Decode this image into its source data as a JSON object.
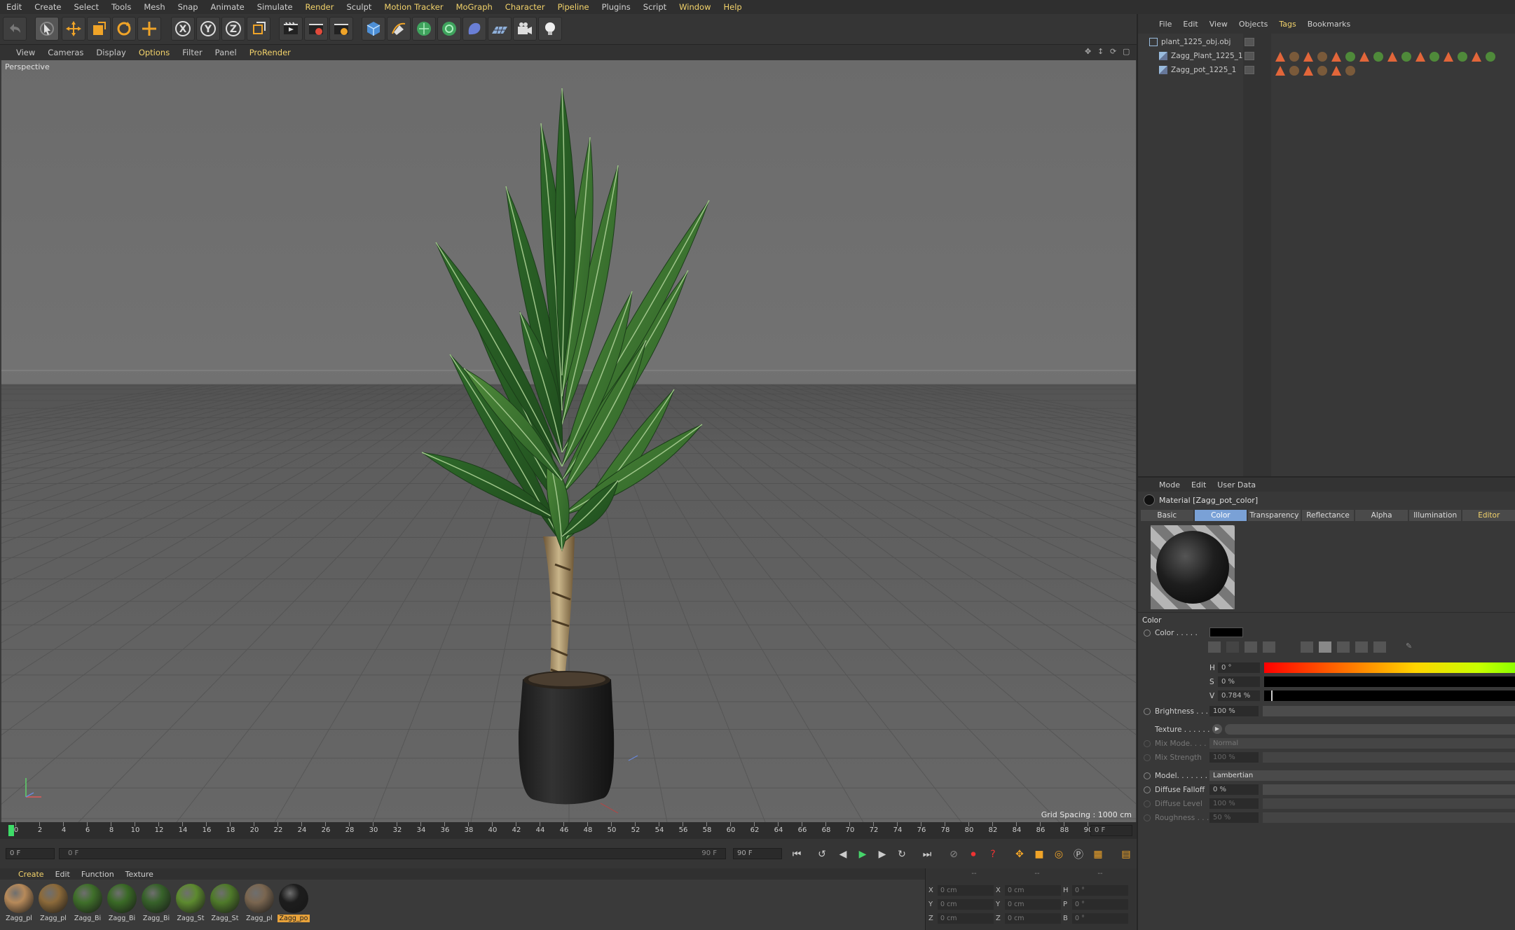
{
  "menubar": [
    "Edit",
    "Create",
    "Select",
    "Tools",
    "Mesh",
    "Snap",
    "Animate",
    "Simulate",
    "Render",
    "Sculpt",
    "Motion Tracker",
    "MoGraph",
    "Character",
    "Pipeline",
    "Plugins",
    "Script",
    "Window",
    "Help"
  ],
  "viewport_menu": [
    "View",
    "Cameras",
    "Display",
    "Options",
    "Filter",
    "Panel",
    "ProRender"
  ],
  "viewport": {
    "label": "Perspective",
    "grid_spacing": "Grid Spacing : 1000 cm"
  },
  "timeline": {
    "ticks": [
      "0",
      "2",
      "4",
      "6",
      "8",
      "10",
      "12",
      "14",
      "16",
      "18",
      "20",
      "22",
      "24",
      "26",
      "28",
      "30",
      "32",
      "34",
      "36",
      "38",
      "40",
      "42",
      "44",
      "46",
      "48",
      "50",
      "52",
      "54",
      "56",
      "58",
      "60",
      "62",
      "64",
      "66",
      "68",
      "70",
      "72",
      "74",
      "76",
      "78",
      "80",
      "82",
      "84",
      "86",
      "88",
      "90"
    ],
    "current_frame": "0 F",
    "start_field": "0 F",
    "range_start": "0 F",
    "range_end": "90 F",
    "end_field": "90 F"
  },
  "material_menu": [
    "Create",
    "Edit",
    "Function",
    "Texture"
  ],
  "materials": [
    {
      "label": "Zagg_pl",
      "color": "#b78a5a"
    },
    {
      "label": "Zagg_pl",
      "color": "#8c6a3a"
    },
    {
      "label": "Zagg_Bi",
      "color": "#3f6f2a"
    },
    {
      "label": "Zagg_Bi",
      "color": "#3a6a26"
    },
    {
      "label": "Zagg_Bi",
      "color": "#37622a"
    },
    {
      "label": "Zagg_St",
      "color": "#5d8a2f"
    },
    {
      "label": "Zagg_St",
      "color": "#4f7a2a"
    },
    {
      "label": "Zagg_pl",
      "color": "#7a6650"
    },
    {
      "label": "Zagg_po",
      "color": "#1d1d1d"
    }
  ],
  "coords": {
    "rows": [
      {
        "a": "X",
        "av": "0 cm",
        "b": "X",
        "bv": "0 cm",
        "c": "H",
        "cv": "0 °"
      },
      {
        "a": "Y",
        "av": "0 cm",
        "b": "Y",
        "bv": "0 cm",
        "c": "P",
        "cv": "0 °"
      },
      {
        "a": "Z",
        "av": "0 cm",
        "b": "Z",
        "bv": "0 cm",
        "c": "B",
        "cv": "0 °"
      }
    ],
    "header": [
      "--",
      "--",
      "--"
    ]
  },
  "object_manager": {
    "menu": [
      "File",
      "Edit",
      "View",
      "Objects",
      "Tags",
      "Bookmarks"
    ],
    "objects": [
      {
        "name": "plant_1225_obj.obj"
      },
      {
        "name": "Zagg_Plant_1225_1"
      },
      {
        "name": "Zagg_pot_1225_1"
      }
    ]
  },
  "attribute_manager": {
    "menu": [
      "Mode",
      "Edit",
      "User Data"
    ],
    "title": "Material [Zagg_pot_color]",
    "tabs": [
      "Basic",
      "Color",
      "Transparency",
      "Reflectance",
      "Alpha",
      "Illumination",
      "Editor"
    ],
    "section": "Color",
    "color_label": "Color . . . . .",
    "h_label": "H",
    "h_value": "0 °",
    "s_label": "S",
    "s_value": "0 %",
    "v_label": "V",
    "v_value": "0.784 %",
    "brightness_label": "Brightness . . .",
    "brightness_value": "100 %",
    "texture_label": "Texture . . . . . .",
    "mixmode_label": "Mix Mode. . . . .",
    "mixmode_value": "Normal",
    "mixstrength_label": "Mix Strength",
    "mixstrength_value": "100 %",
    "model_label": "Model. . . . . . . .",
    "model_value": "Lambertian",
    "diffusefalloff_label": "Diffuse Falloff",
    "diffusefalloff_value": "0 %",
    "diffuselevel_label": "Diffuse Level",
    "diffuselevel_value": "100 %",
    "roughness_label": "Roughness . . .",
    "roughness_value": "50 %"
  }
}
